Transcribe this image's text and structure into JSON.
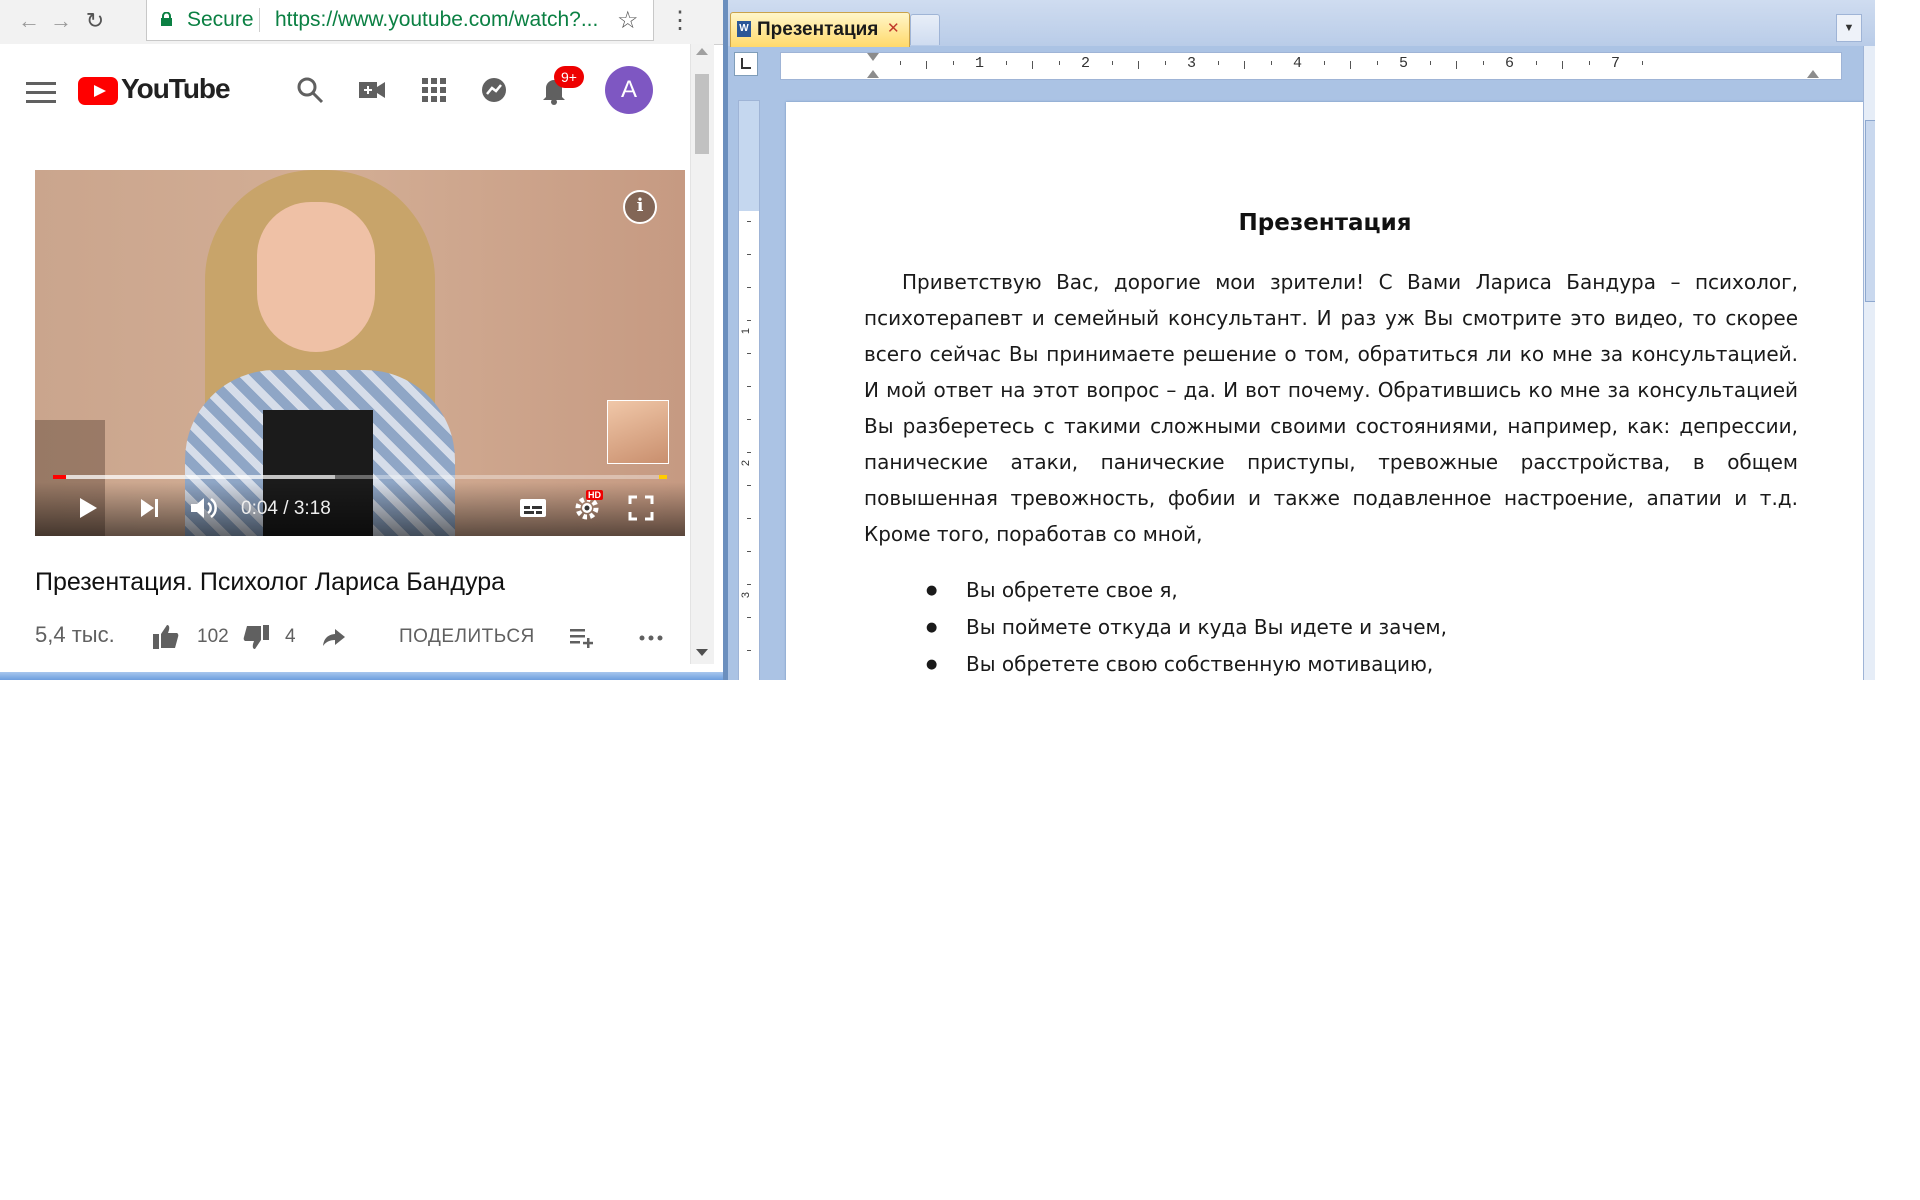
{
  "browser": {
    "secure_label": "Secure",
    "url": "https://www.youtube.com/watch?..."
  },
  "youtube": {
    "logo_text": "YouTube",
    "notification_count": "9+",
    "avatar_letter": "A",
    "player": {
      "time_display": "0:04 / 3:18",
      "hd_badge": "HD",
      "progress_played_fraction": 0.021,
      "progress_buffered_fraction": 0.46
    },
    "video": {
      "title": "Презентация. Психолог Лариса Бандура",
      "views": "5,4 тыс.",
      "likes": "102",
      "dislikes": "4",
      "share_label": "ПОДЕЛИТЬСЯ"
    },
    "icons": [
      "menu-icon",
      "search-icon",
      "create-video-icon",
      "apps-icon",
      "messages-icon",
      "bell-icon",
      "info-icon",
      "play-icon",
      "next-icon",
      "volume-icon",
      "subtitles-icon",
      "settings-icon",
      "fullscreen-icon",
      "like-icon",
      "dislike-icon",
      "share-icon",
      "add-to-playlist-icon",
      "more-icon"
    ],
    "brand_color": "#ff0000"
  },
  "word": {
    "tab_label": "Презентация",
    "ruler_numbers": [
      "1",
      "2",
      "3",
      "4",
      "5",
      "6",
      "7"
    ],
    "vertical_ruler_numbers": [
      "1",
      "2",
      "3"
    ],
    "document": {
      "title": "Презентация",
      "paragraph": "Приветствую Вас, дорогие мои зрители! С Вами Лариса Бандура – психолог, психотерапевт и семейный консультант. И раз уж Вы смотрите это видео, то скорее всего сейчас Вы принимаете решение о том, обратиться ли ко мне за консультацией. И мой ответ на этот вопрос – да. И вот почему. Обратившись ко мне за консультацией Вы разберетесь с такими сложными своими состояниями, например, как: депрессии, панические атаки, панические приступы, тревожные расстройства, в общем повышенная тревожность, фобии и также подавленное настроение, апатии и т.д. Кроме того, поработав со мной,",
      "bullets": [
        "Вы обретете свое я,",
        "Вы поймете откуда и куда Вы идете и зачем,",
        "Вы обретете свою собственную мотивацию,"
      ]
    }
  }
}
